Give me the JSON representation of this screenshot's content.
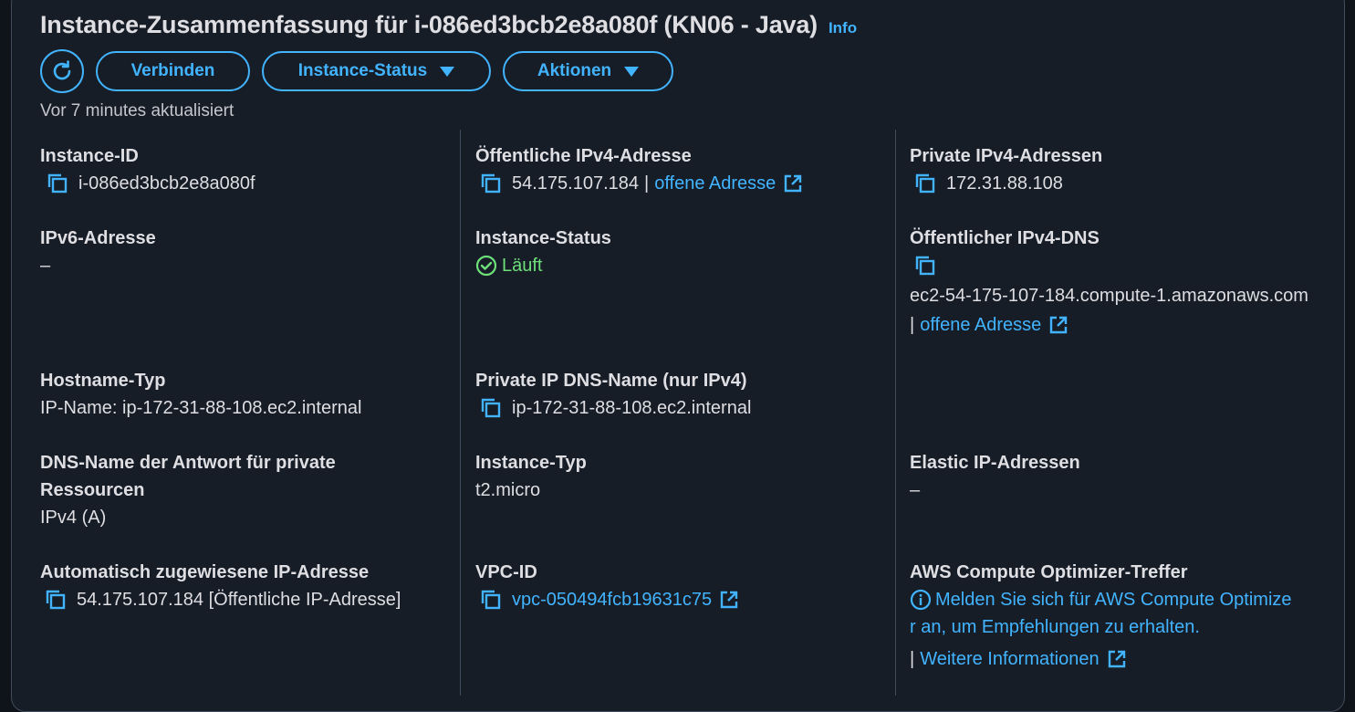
{
  "header": {
    "title": "Instance-Zusammenfassung für i-086ed3bcb2e8a080f (KN06 - Java)",
    "info_label": "Info"
  },
  "toolbar": {
    "refresh_icon": "refresh-icon",
    "connect_label": "Verbinden",
    "instance_state_label": "Instance-Status",
    "actions_label": "Aktionen"
  },
  "updated_text": "Vor 7 minutes aktualisiert",
  "colors": {
    "accent": "#42b4ff",
    "success": "#29ad32",
    "background": "#0f141a",
    "panel": "#161d26"
  },
  "fields": {
    "instance_id": {
      "label": "Instance-ID",
      "value": "i-086ed3bcb2e8a080f"
    },
    "public_ipv4": {
      "label": "Öffentliche IPv4-Adresse",
      "value": "54.175.107.184",
      "separator": "|",
      "link": "offene Adresse"
    },
    "private_ipv4": {
      "label": "Private IPv4-Adressen",
      "value": "172.31.88.108"
    },
    "ipv6": {
      "label": "IPv6-Adresse",
      "value": "–"
    },
    "instance_status": {
      "label": "Instance-Status",
      "value": "Läuft"
    },
    "public_dns": {
      "label": "Öffentlicher IPv4-DNS",
      "value": "ec2-54-175-107-184.compute-1.amazonaws.com",
      "separator": "|",
      "link": "offene Adresse"
    },
    "hostname_type": {
      "label": "Hostname-Typ",
      "value": "IP-Name: ip-172-31-88-108.ec2.internal"
    },
    "private_dns": {
      "label": "Private IP DNS-Name (nur IPv4)",
      "value": "ip-172-31-88-108.ec2.internal"
    },
    "dns_answer": {
      "label_line1": "DNS-Name der Antwort für private",
      "label_line2": "Ressourcen",
      "value": "IPv4 (A)"
    },
    "instance_type": {
      "label": "Instance-Typ",
      "value": "t2.micro"
    },
    "elastic_ip": {
      "label": "Elastic IP-Adressen",
      "value": "–"
    },
    "auto_ip": {
      "label": "Automatisch zugewiesene IP-Adresse",
      "value": "54.175.107.184 [Öffentliche IP-Adresse]"
    },
    "vpc_id": {
      "label": "VPC-ID",
      "value": "vpc-050494fcb19631c75"
    },
    "optimizer": {
      "label": "AWS Compute Optimizer-Treffer",
      "line1": "Melden Sie sich für AWS Compute Optimize",
      "line2": "r an, um Empfehlungen zu erhalten.",
      "separator": "|",
      "link": "Weitere Informationen"
    }
  }
}
